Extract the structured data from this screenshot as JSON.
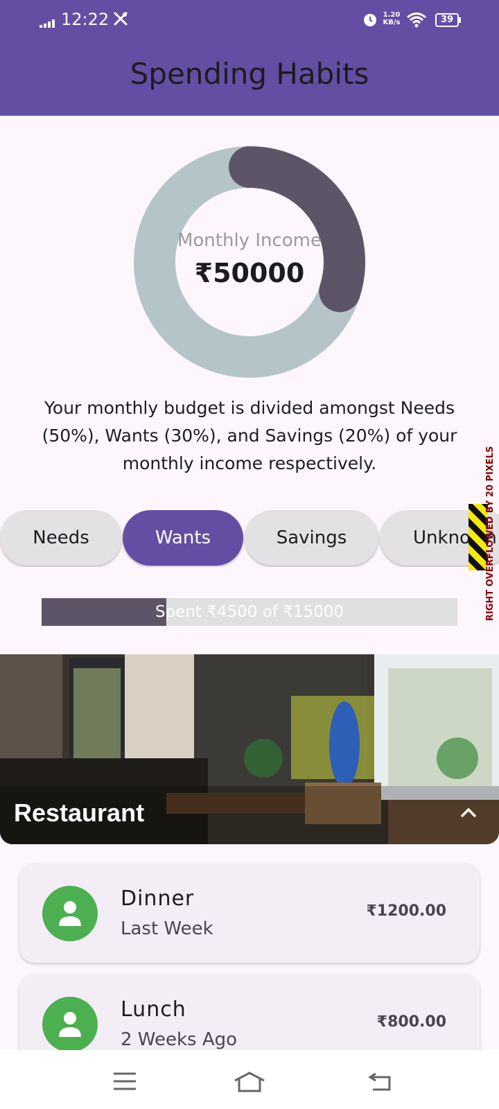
{
  "status_bar": {
    "time": "12:22",
    "net_speed_value": "1.20",
    "net_speed_unit": "KB/s",
    "battery_level": "39"
  },
  "app_bar": {
    "title": "Spending Habits"
  },
  "income_summary": {
    "label": "Monthly Income",
    "value": "₹50000",
    "ring_fraction": 0.3,
    "ring_color": "#5e5468",
    "ring_track_color": "#b5c4c9"
  },
  "budget_description": "Your monthly budget is divided amongst Needs (50%), Wants (30%), and Savings (20%) of your monthly income respectively.",
  "categories": {
    "tabs": [
      "Needs",
      "Wants",
      "Savings",
      "Unknown"
    ],
    "selected": "Wants",
    "overflow_warning": "RIGHT OVERFLOWED BY 20 PIXELS"
  },
  "spending_progress": {
    "text": "Spent ₹4500 of ₹15000",
    "fraction": 0.3
  },
  "restaurant_section": {
    "title": "Restaurant"
  },
  "transactions": [
    {
      "name": "Dinner",
      "time": "Last Week",
      "amount": "₹1200.00"
    },
    {
      "name": "Lunch",
      "time": "2 Weeks Ago",
      "amount": "₹800.00"
    }
  ],
  "colors": {
    "primary": "#644ea3",
    "avatar_green": "#4caf50"
  }
}
